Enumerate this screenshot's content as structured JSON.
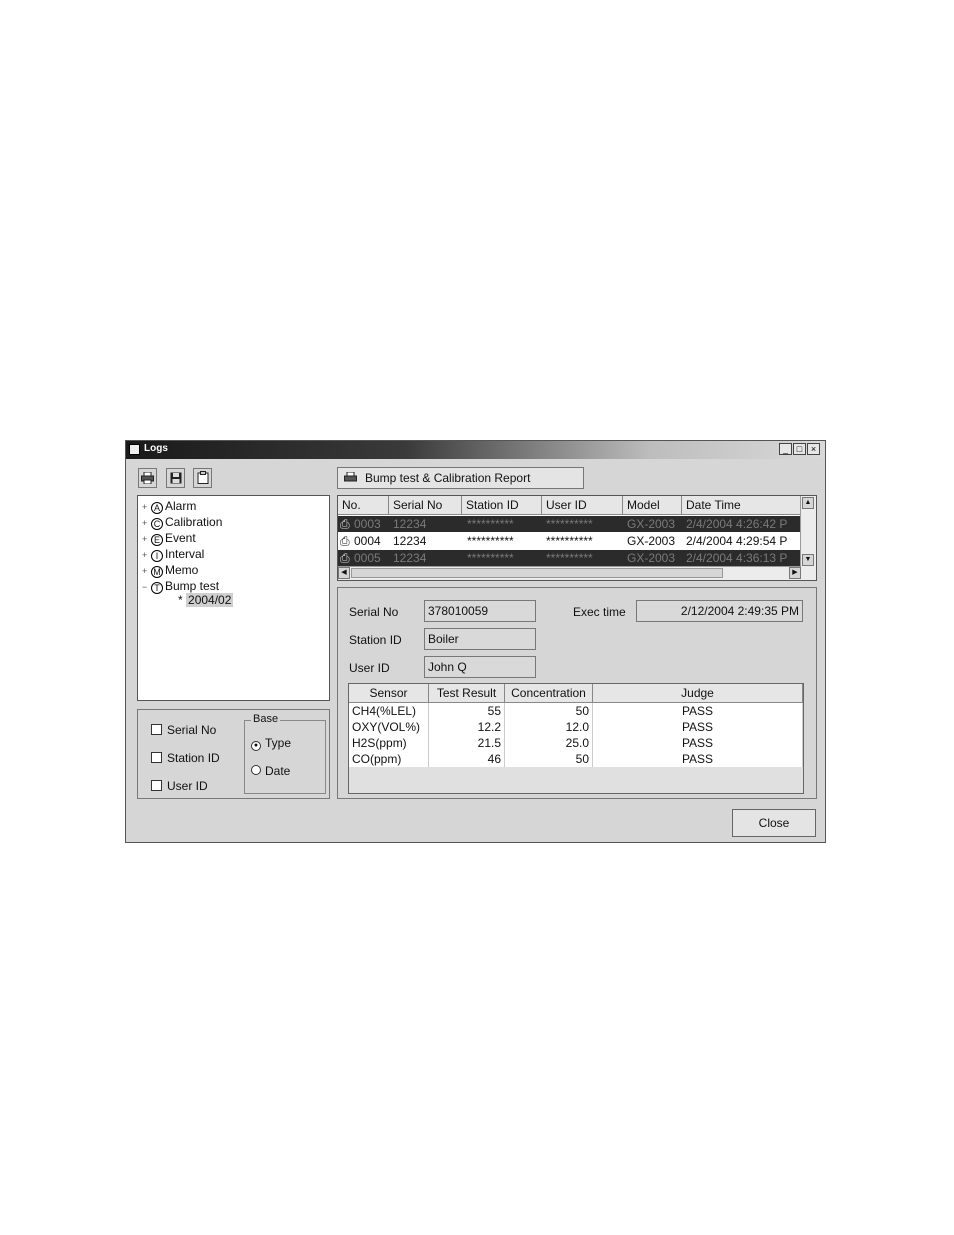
{
  "window": {
    "title": "Logs",
    "minimize": "_",
    "maximize": "□",
    "close": "×"
  },
  "toolbar": {
    "print_icon": "printer-icon",
    "save_icon": "save-icon",
    "clipboard_icon": "clipboard-icon",
    "report_label": "Bump test & Calibration Report"
  },
  "tree": {
    "items": [
      {
        "letter": "A",
        "label": "Alarm",
        "expander": "+"
      },
      {
        "letter": "C",
        "label": "Calibration",
        "expander": "+"
      },
      {
        "letter": "E",
        "label": "Event",
        "expander": "+"
      },
      {
        "letter": "I",
        "label": "Interval",
        "expander": "+"
      },
      {
        "letter": "M",
        "label": "Memo",
        "expander": "+"
      },
      {
        "letter": "T",
        "label": "Bump test",
        "expander": "−"
      }
    ],
    "child": {
      "mark": "*",
      "label": "2004/02"
    }
  },
  "filters": {
    "checkboxes": [
      "Serial No",
      "Station ID",
      "User ID"
    ],
    "base_label": "Base",
    "radios": [
      {
        "label": "Type",
        "selected": true
      },
      {
        "label": "Date",
        "selected": false
      }
    ]
  },
  "records": {
    "columns": [
      "No.",
      "Serial No",
      "Station ID",
      "User ID",
      "Model",
      "Date Time"
    ],
    "rows": [
      {
        "no": "0003",
        "serial": "12234",
        "station": "**********",
        "user": "**********",
        "model": "GX-2003",
        "datetime": "2/4/2004 4:26:42 P",
        "highlight": true
      },
      {
        "no": "0004",
        "serial": "12234",
        "station": "**********",
        "user": "**********",
        "model": "GX-2003",
        "datetime": "2/4/2004 4:29:54 P",
        "highlight": false
      },
      {
        "no": "0005",
        "serial": "12234",
        "station": "**********",
        "user": "**********",
        "model": "GX-2003",
        "datetime": "2/4/2004 4:36:13 P",
        "highlight": true
      }
    ]
  },
  "detail": {
    "serial_label": "Serial No",
    "serial_value": "378010059",
    "station_label": "Station ID",
    "station_value": "Boiler",
    "user_label": "User ID",
    "user_value": "John Q",
    "exec_label": "Exec time",
    "exec_value": "2/12/2004 2:49:35 PM"
  },
  "sensors": {
    "columns": [
      "Sensor",
      "Test Result",
      "Concentration",
      "Judge"
    ],
    "rows": [
      {
        "sensor": "CH4(%LEL)",
        "result": "55",
        "concentration": "50",
        "judge": "PASS"
      },
      {
        "sensor": "OXY(VOL%)",
        "result": "12.2",
        "concentration": "12.0",
        "judge": "PASS"
      },
      {
        "sensor": "H2S(ppm)",
        "result": "21.5",
        "concentration": "25.0",
        "judge": "PASS"
      },
      {
        "sensor": "CO(ppm)",
        "result": "46",
        "concentration": "50",
        "judge": "PASS"
      }
    ]
  },
  "footer": {
    "close_label": "Close"
  }
}
